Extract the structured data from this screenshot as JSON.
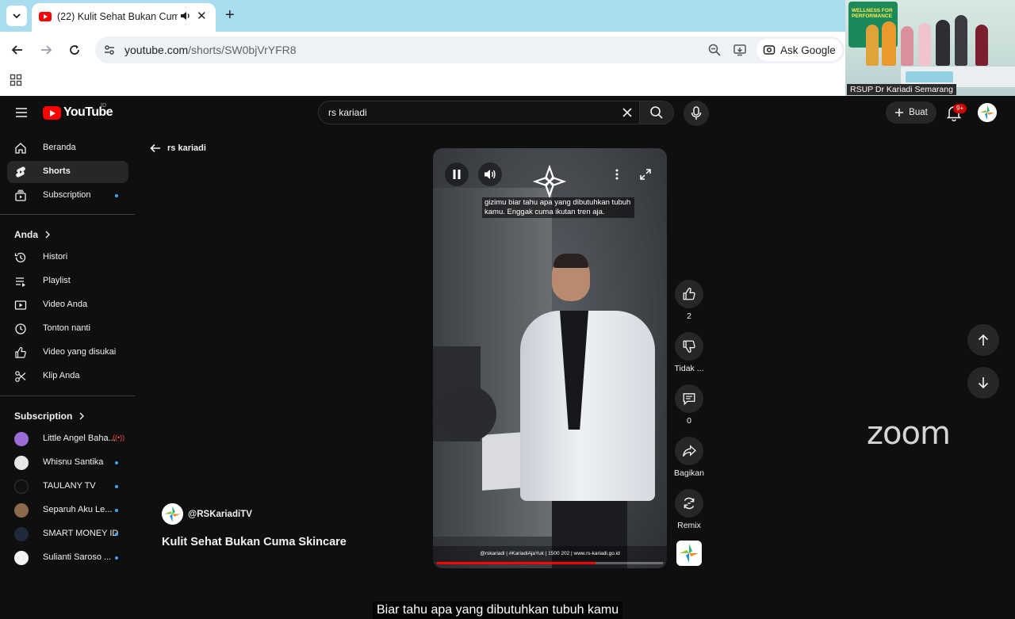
{
  "browser": {
    "tab_title": "(22) Kulit Sehat Bukan Cuma Skincare",
    "url_domain": "youtube.com",
    "url_path": "/shorts/SW0bjVrYFR8",
    "ask_google": "Ask Google"
  },
  "zoom": {
    "participant_label": "RSUP Dr Kariadi Semarang",
    "banner_text": "WELLNESS FOR PERFORMANCE",
    "watermark": "zoom"
  },
  "youtube": {
    "logo_text": "YouTube",
    "logo_country": "ID",
    "search_value": "rs kariadi",
    "create_label": "Buat",
    "notif_badge": "9+"
  },
  "sidebar": {
    "main": [
      {
        "label": "Beranda",
        "icon": "home-icon"
      },
      {
        "label": "Shorts",
        "icon": "shorts-icon",
        "active": true
      },
      {
        "label": "Subscription",
        "icon": "subscription-icon"
      }
    ],
    "you_heading": "Anda",
    "you_items": [
      {
        "label": "Histori",
        "icon": "history-icon"
      },
      {
        "label": "Playlist",
        "icon": "playlist-icon"
      },
      {
        "label": "Video Anda",
        "icon": "video-icon"
      },
      {
        "label": "Tonton nanti",
        "icon": "clock-icon"
      },
      {
        "label": "Video yang disukai",
        "icon": "thumbs-up-icon"
      },
      {
        "label": "Klip Anda",
        "icon": "scissors-icon"
      }
    ],
    "subs_heading": "Subscription",
    "subs": [
      {
        "label": "Little Angel Baha...",
        "color": "#9b6bd6",
        "live": true
      },
      {
        "label": "Whisnu Santika",
        "color": "#e6e6e6"
      },
      {
        "label": "TAULANY TV",
        "color": "#111111"
      },
      {
        "label": "Separuh Aku Le...",
        "color": "#8a6a4a"
      },
      {
        "label": "SMART MONEY ID",
        "color": "#1e2a3a"
      },
      {
        "label": "Sulianti Saroso ...",
        "color": "#f2f2f2"
      }
    ]
  },
  "shorts": {
    "back_label": "rs kariadi",
    "top_caption": "gizimu biar tahu apa yang dibutuhkan tubuh kamu. Enggak cuma ikutan tren aja.",
    "bottom_caption": "Biar tahu apa yang dibutuhkan tubuh kamu",
    "footer_strip": "@rskariadi  |  #KariadiAjaYuk  |  1500 202  |  www.rs-kariadi.go.id",
    "progress": 0.7,
    "channel": "@RSKariadiTV",
    "title": "Kulit Sehat Bukan Cuma Skincare",
    "actions": {
      "like_count": "2",
      "dislike_label": "Tidak ...",
      "comment_count": "0",
      "share_label": "Bagikan",
      "remix_label": "Remix"
    }
  }
}
